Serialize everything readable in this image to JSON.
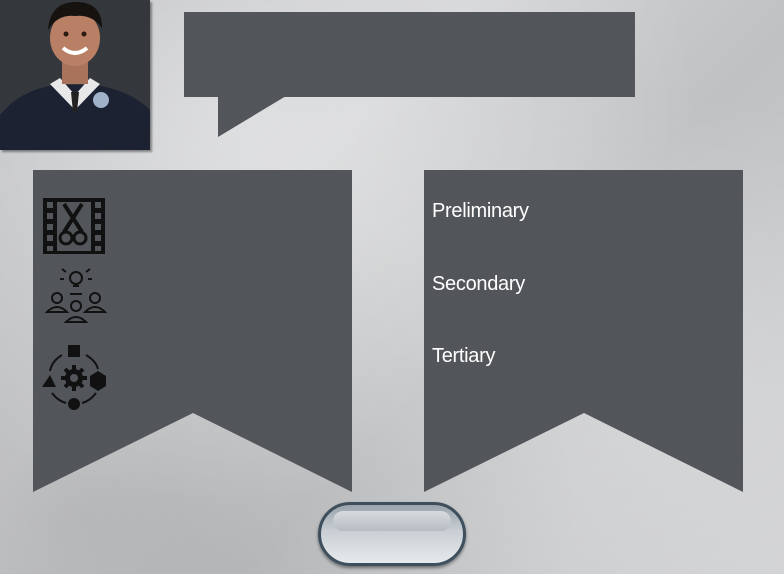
{
  "profile": {
    "photo_alt": ""
  },
  "speech_bubble": {
    "text": ""
  },
  "left_panel": {
    "icons": [
      "film-editing-icon",
      "team-idea-icon",
      "workflow-process-icon"
    ]
  },
  "right_panel": {
    "items": [
      {
        "label": "Preliminary"
      },
      {
        "label": "Secondary"
      },
      {
        "label": "Tertiary"
      }
    ]
  },
  "bottom_button": {
    "label": ""
  },
  "colors": {
    "panel": "#52565a",
    "icon": "#111111",
    "text": "#ffffff",
    "button_border": "#3d4e5c"
  }
}
